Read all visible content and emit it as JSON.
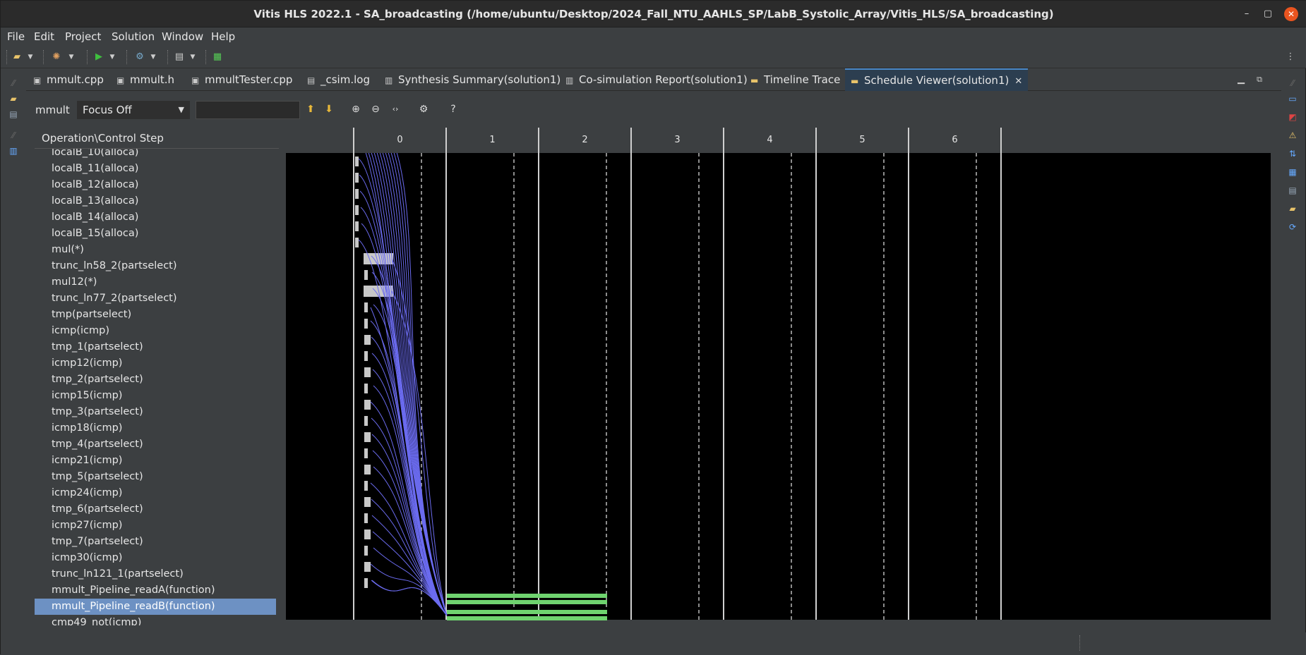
{
  "window": {
    "title": "Vitis HLS 2022.1 - SA_broadcasting (/home/ubuntu/Desktop/2024_Fall_NTU_AAHLS_SP/LabB_Systolic_Array/Vitis_HLS/SA_broadcasting)",
    "minimize": "–",
    "restore": "▢",
    "close": "✕"
  },
  "menu": [
    "File",
    "Edit",
    "Project",
    "Solution",
    "Window",
    "Help"
  ],
  "tabs": [
    {
      "label": "mmult.cpp",
      "icon": "cpp-file-icon"
    },
    {
      "label": "mmult.h",
      "icon": "header-file-icon"
    },
    {
      "label": "mmultTester.cpp",
      "icon": "cpp-file-icon"
    },
    {
      "label": "_csim.log",
      "icon": "log-file-icon"
    },
    {
      "label": "Synthesis Summary(solution1)",
      "icon": "report-icon"
    },
    {
      "label": "Co-simulation Report(solution1)",
      "icon": "report-icon"
    },
    {
      "label": "Timeline Trace",
      "icon": "timeline-icon"
    },
    {
      "label": "Schedule Viewer(solution1)",
      "icon": "schedule-icon",
      "active": true
    }
  ],
  "viewer": {
    "function_name": "mmult",
    "focus": "Focus Off",
    "search_value": "",
    "list_header": "Operation\\Control Step",
    "steps": [
      "0",
      "1",
      "2",
      "3",
      "4",
      "5",
      "6"
    ],
    "selected_row": "mmult_Pipeline_readB(function)",
    "operations": [
      "localB_10(alloca)",
      "localB_11(alloca)",
      "localB_12(alloca)",
      "localB_13(alloca)",
      "localB_14(alloca)",
      "localB_15(alloca)",
      "mul(*)",
      "trunc_ln58_2(partselect)",
      "mul12(*)",
      "trunc_ln77_2(partselect)",
      "tmp(partselect)",
      "icmp(icmp)",
      "tmp_1(partselect)",
      "icmp12(icmp)",
      "tmp_2(partselect)",
      "icmp15(icmp)",
      "tmp_3(partselect)",
      "icmp18(icmp)",
      "tmp_4(partselect)",
      "icmp21(icmp)",
      "tmp_5(partselect)",
      "icmp24(icmp)",
      "tmp_6(partselect)",
      "icmp27(icmp)",
      "tmp_7(partselect)",
      "icmp30(icmp)",
      "trunc_ln121_1(partselect)",
      "mmult_Pipeline_readA(function)",
      "mmult_Pipeline_readB(function)",
      "cmp49_not(icmp)"
    ]
  },
  "colors": {
    "chart_bg": "#000000",
    "op_bar": "#c8c8c8",
    "function_bar": "#6fd36f",
    "dependency_line": "#6b6bef",
    "selection": "#6d91c3"
  }
}
